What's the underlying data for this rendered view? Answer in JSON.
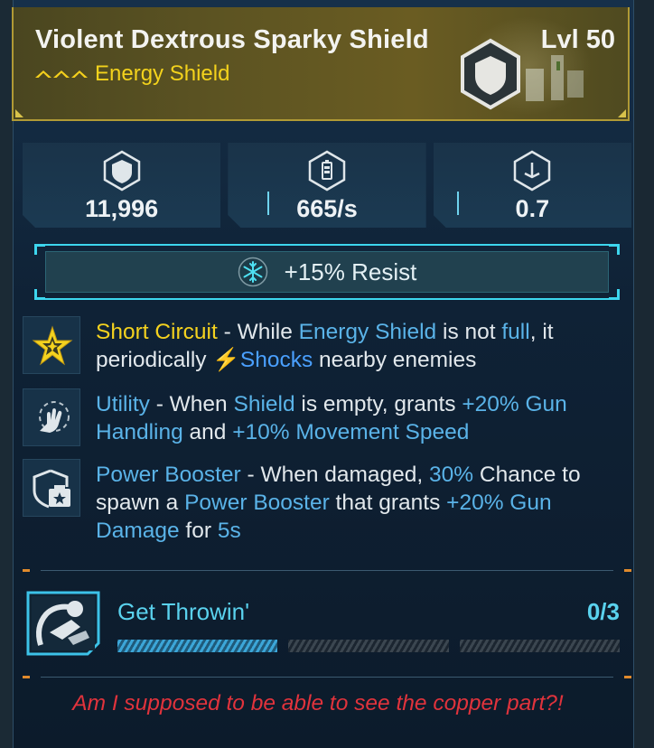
{
  "item": {
    "name": "Violent Dextrous Sparky Shield",
    "level": "Lvl 50",
    "type": "Energy Shield",
    "rarity_color": "#f3cf1c",
    "type_icon": "shield-emblem-icon"
  },
  "stats": [
    {
      "icon": "shield-capacity-icon",
      "value": "11,996"
    },
    {
      "icon": "recharge-rate-icon",
      "value": "665/s"
    },
    {
      "icon": "recharge-delay-icon",
      "value": "0.7"
    }
  ],
  "resist": {
    "icon": "cryo-snowflake-icon",
    "label": "+15% Resist",
    "accent": "#3dd6ee"
  },
  "perks": [
    {
      "icon": "star-burst-icon",
      "segments": [
        {
          "t": "Short Circuit",
          "c": "yellow"
        },
        {
          "t": " - While ",
          "c": "white"
        },
        {
          "t": "Energy Shield",
          "c": "blue"
        },
        {
          "t": " is not ",
          "c": "white"
        },
        {
          "t": "full",
          "c": "blue"
        },
        {
          "t": ", it periodically ",
          "c": "white"
        },
        {
          "t": "⚡",
          "c": "shock"
        },
        {
          "t": "Shocks",
          "c": "shock"
        },
        {
          "t": " nearby enemies",
          "c": "white"
        }
      ]
    },
    {
      "icon": "hand-grab-icon",
      "segments": [
        {
          "t": "Utility",
          "c": "blue"
        },
        {
          "t": " - When ",
          "c": "white"
        },
        {
          "t": "Shield",
          "c": "blue"
        },
        {
          "t": " is empty, grants ",
          "c": "white"
        },
        {
          "t": "+20% Gun Handling",
          "c": "blue"
        },
        {
          "t": " and ",
          "c": "white"
        },
        {
          "t": "+10% Movement Speed",
          "c": "blue"
        }
      ]
    },
    {
      "icon": "power-booster-icon",
      "segments": [
        {
          "t": "Power Booster",
          "c": "blue"
        },
        {
          "t": " - When damaged, ",
          "c": "white"
        },
        {
          "t": "30%",
          "c": "blue"
        },
        {
          "t": " Chance to spawn a ",
          "c": "white"
        },
        {
          "t": "Power Booster",
          "c": "blue"
        },
        {
          "t": " that grants ",
          "c": "white"
        },
        {
          "t": "+20% Gun Damage",
          "c": "blue"
        },
        {
          "t": " for ",
          "c": "white"
        },
        {
          "t": "5s",
          "c": "blue"
        }
      ]
    }
  ],
  "challenge": {
    "icon": "throwing-arm-icon",
    "title": "Get Throwin'",
    "count": "0/3",
    "completed_segments": 1,
    "total_segments": 3
  },
  "flavor": "Am I supposed to be able to see the copper part?!",
  "colors": {
    "yellow": "#f4d21f",
    "blue": "#5ab3e8",
    "shock": "#4aa0ff",
    "flavor_red": "#e0333c"
  }
}
